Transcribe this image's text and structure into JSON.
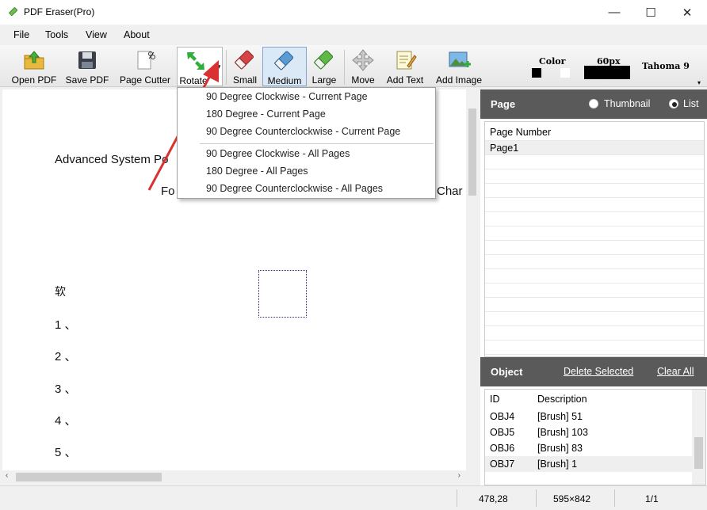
{
  "window": {
    "title": "PDF Eraser(Pro)",
    "minimize": "—",
    "maximize": "☐",
    "close": "✕"
  },
  "menu": [
    "File",
    "Tools",
    "View",
    "About"
  ],
  "toolbar": {
    "open_pdf": "Open PDF",
    "save_pdf": "Save PDF",
    "page_cutter": "Page Cutter",
    "rotate": "Rotate",
    "small": "Small",
    "medium": "Medium",
    "large": "Large",
    "move": "Move",
    "add_text": "Add Text",
    "add_image": "Add Image",
    "color_label": "Color",
    "size_label": "60px",
    "font_label": "Tahoma 9"
  },
  "rotate_menu": {
    "items": [
      "90 Degree Clockwise - Current Page",
      "180 Degree - Current Page",
      "90 Degree Counterclockwise - Current Page",
      "90 Degree Clockwise - All Pages",
      "180 Degree - All Pages",
      "90 Degree Counterclockwise - All Pages"
    ]
  },
  "document": {
    "line1": "Advanced System Po",
    "line2": "Fo",
    "line2_right": "Char",
    "char": "软",
    "items": [
      "1 、",
      "2 、",
      "3 、",
      "4 、",
      "5 、"
    ]
  },
  "page_panel": {
    "title": "Page",
    "thumbnail_label": "Thumbnail",
    "list_label": "List",
    "column": "Page Number",
    "rows": [
      "Page1"
    ]
  },
  "object_panel": {
    "title": "Object",
    "delete_selected": "Delete Selected",
    "clear_all": "Clear All",
    "col_id": "ID",
    "col_desc": "Description",
    "rows": [
      {
        "id": "OBJ4",
        "desc": "[Brush] 51"
      },
      {
        "id": "OBJ5",
        "desc": "[Brush] 103"
      },
      {
        "id": "OBJ6",
        "desc": "[Brush] 83"
      },
      {
        "id": "OBJ7",
        "desc": "[Brush] 1"
      }
    ]
  },
  "status": {
    "coords": "478,28",
    "page_size": "595×842",
    "page_num": "1/1"
  },
  "colors": {
    "accent_arrow": "#d83232",
    "panel_header": "#5a5a5a",
    "selected_row": "#efefef"
  }
}
